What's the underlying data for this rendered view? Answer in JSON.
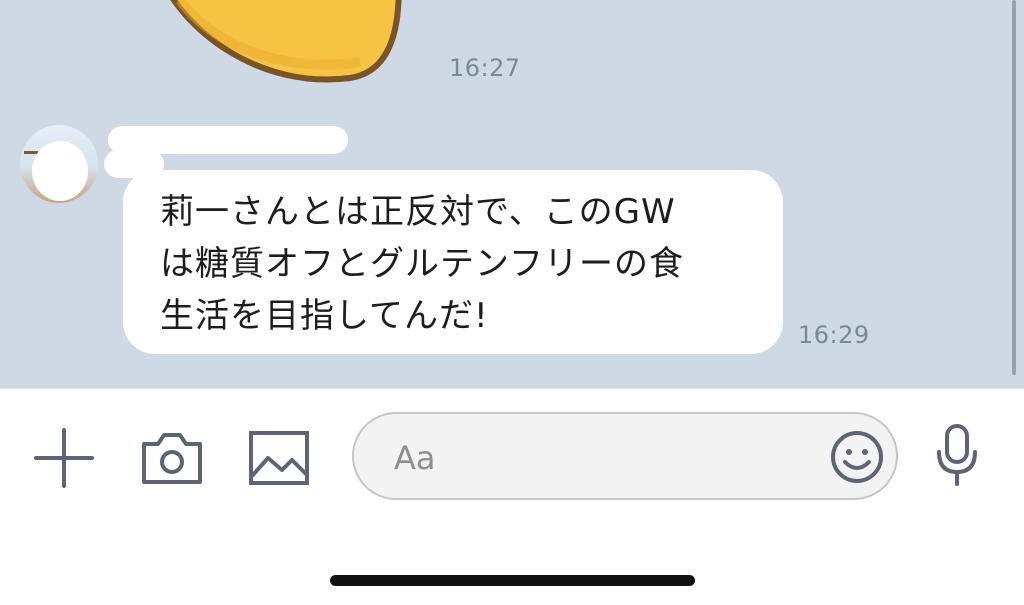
{
  "messages": [
    {
      "type": "sticker",
      "time": "16:27"
    },
    {
      "type": "text",
      "text": "莉一さんとは正反対で、このGW\nは糖質オフとグルテンフリーの食\n生活を目指してんだ!",
      "time": "16:29"
    }
  ],
  "composer": {
    "placeholder": "Aa"
  },
  "icons": {
    "plus": "plus-icon",
    "camera": "camera-icon",
    "image": "image-icon",
    "emoji": "emoji-icon",
    "mic": "microphone-icon"
  },
  "colors": {
    "chat_background": "#cfd9e5",
    "bubble": "#ffffff",
    "timestamp": "#7d8896",
    "icon_stroke": "#5c6575",
    "sticker_fill": "#f7c343"
  }
}
